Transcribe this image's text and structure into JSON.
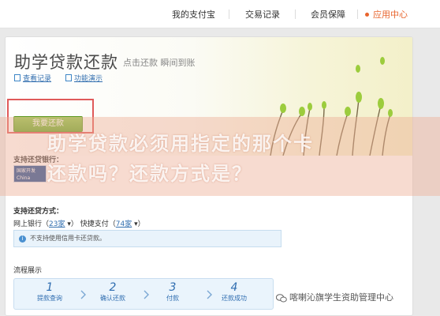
{
  "topnav": {
    "items": [
      "我的支付宝",
      "交易记录",
      "会员保障",
      "应用中心"
    ],
    "active_index": 3
  },
  "header": {
    "title": "助学贷款还款",
    "subtitle": "点击还款 瞬间到账",
    "links": [
      "查看记录",
      "功能演示"
    ]
  },
  "action": {
    "repay_label": "我要还款"
  },
  "banks": {
    "label": "支持还贷银行：",
    "logo_text": "国家开发 China Develop"
  },
  "methods": {
    "label": "支持还贷方式：",
    "online_label": "网上银行",
    "online_count": "23家",
    "express_label": "快捷支付",
    "express_count": "74家",
    "notice": "不支持使用信用卡还贷款。"
  },
  "process": {
    "label": "流程展示",
    "steps": [
      {
        "num": "1",
        "label": "提款查询"
      },
      {
        "num": "2",
        "label": "确认还款"
      },
      {
        "num": "3",
        "label": "付款"
      },
      {
        "num": "4",
        "label": "还款成功"
      }
    ]
  },
  "overlay": {
    "line1": "助学贷款必须用指定的那个卡",
    "line2": "还款吗？还款方式是？"
  },
  "wechat": {
    "label": "喀喇沁旗学生资助管理中心"
  },
  "colors": {
    "accent": "#e8642c",
    "button": "#6aab2e",
    "link": "#3470b0"
  }
}
